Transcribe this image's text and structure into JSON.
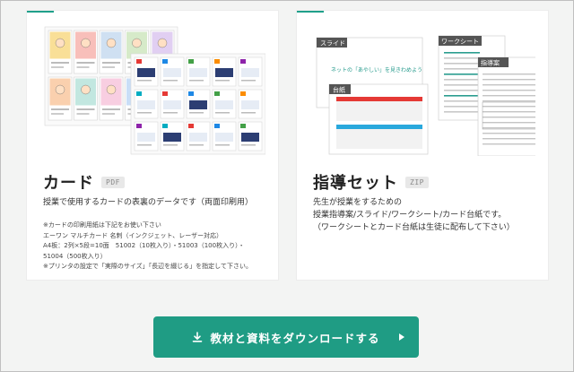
{
  "cards": {
    "title": "カード",
    "tag": "PDF",
    "description": "授業で使用するカードの表裏のデータです（両面印刷用）",
    "notes": [
      "※カードの印刷用紙は下記をお使い下さい",
      "エーワン マルチカード 名刺（インクジェット、レーザー対応）",
      "A4板：2列×5段=10面　51002（10枚入り）・51003（100枚入り）・",
      "51004（500枚入り）",
      "※プリンタの設定で「実際のサイズ」「長辺を綴じる」を指定して下さい。"
    ]
  },
  "guide_set": {
    "title": "指導セット",
    "tag": "ZIP",
    "description_lines": [
      "先生が授業をするための",
      "授業指導案/スライド/ワークシート/カード台紙です。",
      "（ワークシートとカード台紙は生徒に配布して下さい）"
    ],
    "preview": {
      "slide_label": "スライド",
      "slide_text": "ネットの「あやしい」を見きわめよう",
      "board_label": "台紙",
      "worksheet_label": "ワークシート",
      "plan_label": "指導案"
    }
  },
  "download_button": {
    "label": "教材と資料をダウンロードする"
  },
  "colors": {
    "accent": "#1f9c84",
    "slide_red": "#e53935",
    "slide_blue": "#29a8dc"
  }
}
